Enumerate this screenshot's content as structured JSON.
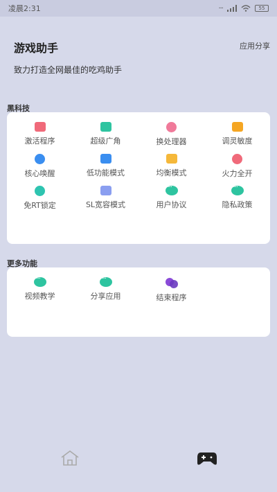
{
  "status_bar": {
    "time": "凌晨2:31",
    "battery": "55"
  },
  "header": {
    "title": "游戏助手",
    "share": "应用分享",
    "tagline": "致力打造全网最佳的吃鸡助手"
  },
  "sections": [
    {
      "label": "黑科技",
      "items": [
        {
          "label": "激活程序",
          "icon": "monitor-icon",
          "color": "#f06a7a"
        },
        {
          "label": "超级广角",
          "icon": "image-icon",
          "color": "#2ec4a0"
        },
        {
          "label": "换处理器",
          "icon": "cpu-icon",
          "color": "#f07a9a"
        },
        {
          "label": "调灵敏度",
          "icon": "printer-icon",
          "color": "#f5a623"
        },
        {
          "label": "核心唤醒",
          "icon": "wave-icon",
          "color": "#3a8ef0"
        },
        {
          "label": "低功能模式",
          "icon": "chip-icon",
          "color": "#3a8ef0"
        },
        {
          "label": "均衡模式",
          "icon": "balance-icon",
          "color": "#f5b83a"
        },
        {
          "label": "火力全开",
          "icon": "fire-icon",
          "color": "#f06a7a"
        },
        {
          "label": "免RT锁定",
          "icon": "eye-icon",
          "color": "#2ec4b0"
        },
        {
          "label": "SL宽容模式",
          "icon": "gamepad-icon",
          "color": "#8a9ef0"
        },
        {
          "label": "用户协议",
          "icon": "chat-bubble-icon",
          "color": "#2ec4a0"
        },
        {
          "label": "隐私政策",
          "icon": "chat-bubble-icon",
          "color": "#2ec4a0"
        }
      ]
    },
    {
      "label": "更多功能",
      "items": [
        {
          "label": "视频教学",
          "icon": "chat-bubble-icon",
          "color": "#2ec4a0"
        },
        {
          "label": "分享应用",
          "icon": "chat-bubble-icon",
          "color": "#2ec4a0"
        },
        {
          "label": "结束程序",
          "icon": "bubbles-icon",
          "color": "#8a4ad8"
        }
      ]
    }
  ],
  "tabbar": [
    {
      "name": "home",
      "icon": "home-icon",
      "active": false
    },
    {
      "name": "game",
      "icon": "gamepad-icon",
      "active": true
    }
  ]
}
